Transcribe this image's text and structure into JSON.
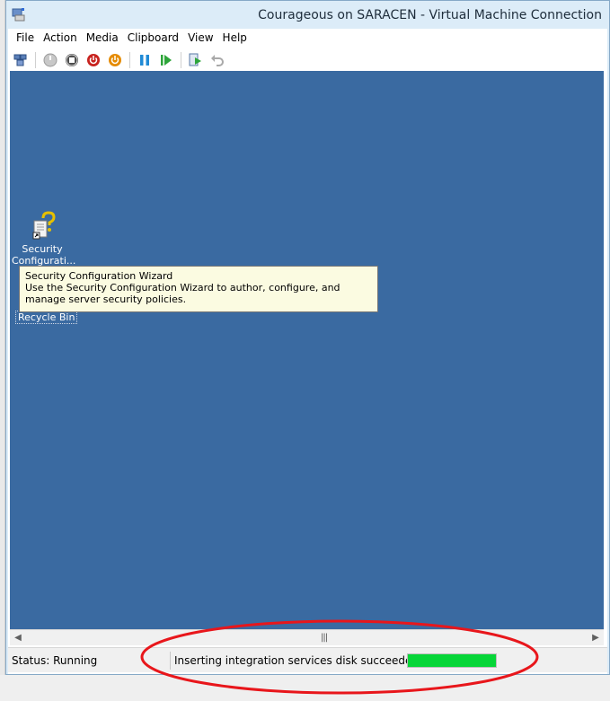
{
  "window": {
    "title": "Courageous on SARACEN - Virtual Machine Connection",
    "frame_color": "#dcecf8"
  },
  "menu": [
    "File",
    "Action",
    "Media",
    "Clipboard",
    "View",
    "Help"
  ],
  "toolbar": {
    "icons": [
      "ctrl-alt-del-icon",
      "start-icon",
      "turn-off-icon",
      "shut-down-icon",
      "save-icon",
      "pause-icon",
      "reset-icon",
      "checkpoint-icon",
      "revert-icon"
    ]
  },
  "desktop": {
    "background": "#3a6aa1",
    "icon_label_line1": "Security",
    "icon_label_line2": "Configurati...",
    "recycle_bin_label": "Recycle Bin"
  },
  "tooltip": {
    "title": "Security Configuration Wizard",
    "body": "Use the Security Configuration Wizard to author, configure, and manage server security policies."
  },
  "status": {
    "state": "Status: Running",
    "message": "Inserting integration services disk succeeded",
    "progress_fraction": 1.0,
    "progress_color": "#06d638"
  },
  "annotation_color": "#e8161b"
}
